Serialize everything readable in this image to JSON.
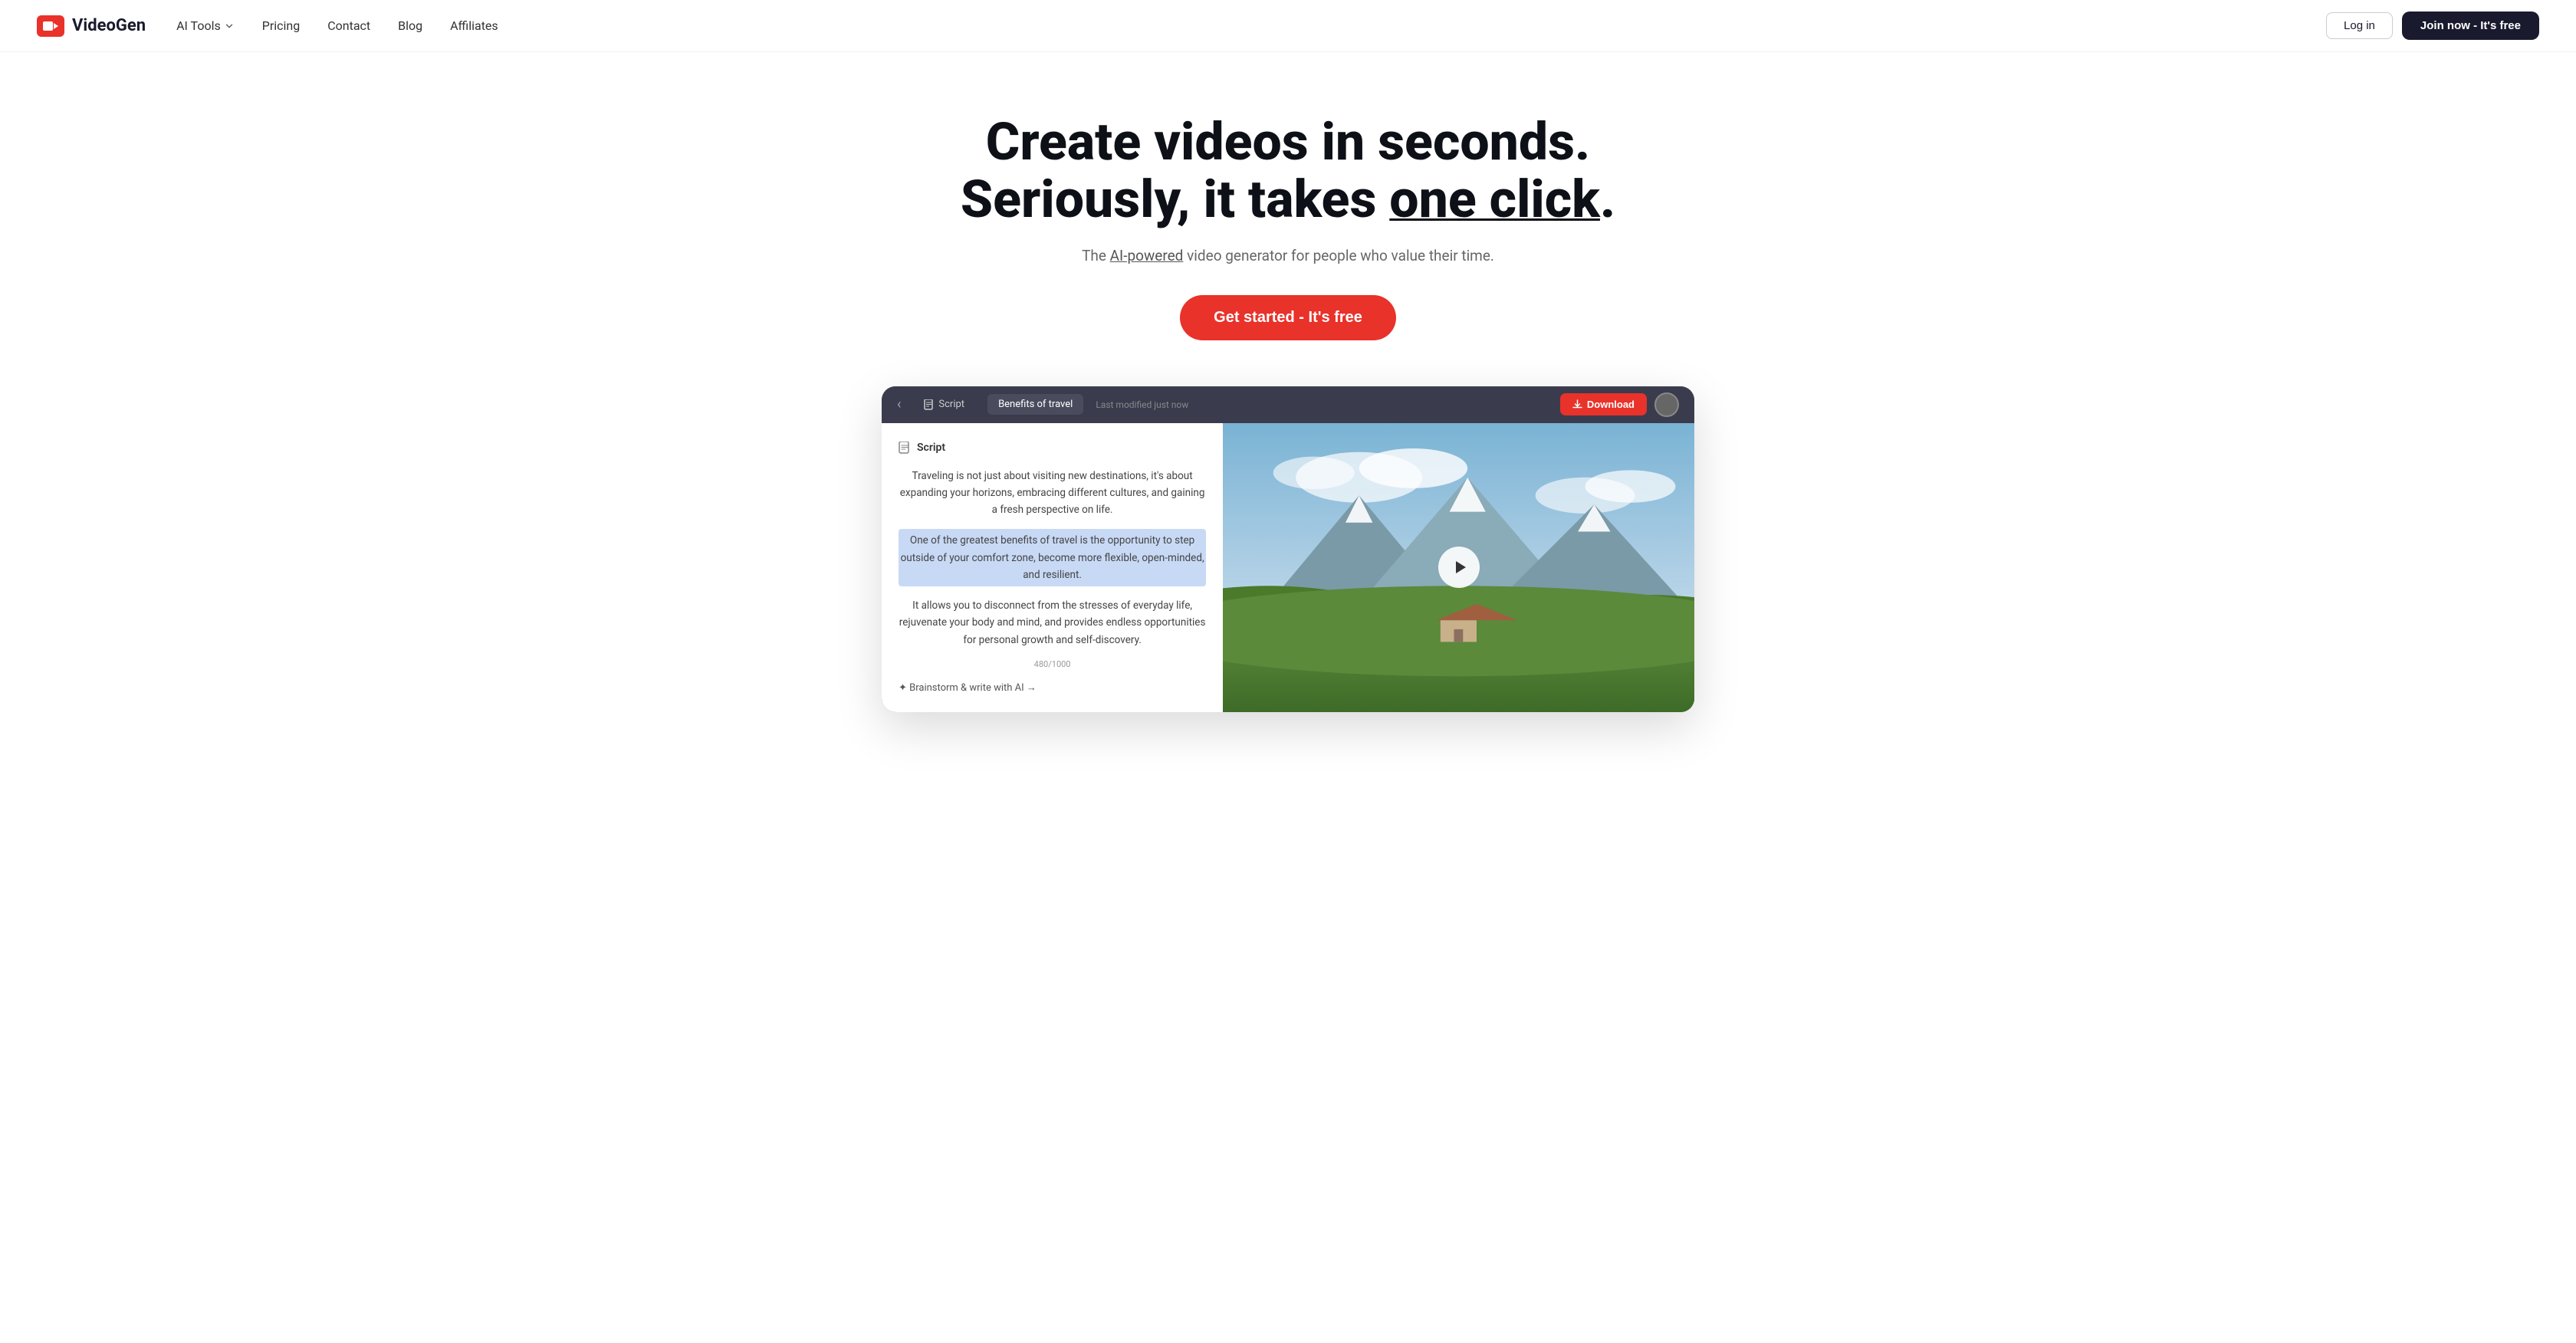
{
  "navbar": {
    "logo_text": "VideoGen",
    "nav_items": [
      {
        "label": "AI Tools",
        "has_dropdown": true,
        "id": "ai-tools"
      },
      {
        "label": "Pricing",
        "has_dropdown": false,
        "id": "pricing"
      },
      {
        "label": "Contact",
        "has_dropdown": false,
        "id": "contact"
      },
      {
        "label": "Blog",
        "has_dropdown": false,
        "id": "blog"
      },
      {
        "label": "Affiliates",
        "has_dropdown": false,
        "id": "affiliates"
      }
    ],
    "login_label": "Log in",
    "join_label": "Join now - It's free"
  },
  "hero": {
    "title_line1": "Create videos in seconds.",
    "title_line2_pre": "Seriously, it takes ",
    "title_line2_highlight": "one click",
    "title_line2_post": ".",
    "subtitle_pre": "The ",
    "subtitle_link": "AI-powered",
    "subtitle_post": " video generator for people who value their time.",
    "cta_label_bold": "Get started",
    "cta_label_rest": " - It's free"
  },
  "app_preview": {
    "back_button": "‹",
    "tabs": [
      {
        "label": "Script",
        "icon": "document",
        "active": false
      },
      {
        "label": "Benefits of travel",
        "icon": "",
        "active": true
      }
    ],
    "last_modified": "Last modified just now",
    "download_label": "Download",
    "script_section": {
      "heading": "Script",
      "paragraphs": [
        {
          "text": "Traveling is not just about visiting new destinations, it's about expanding your horizons, embracing different cultures, and gaining a fresh perspective on life.",
          "highlighted": false
        },
        {
          "text": "One of the greatest benefits of travel is the opportunity to step outside of your comfort zone, become more flexible, open-minded, and resilient.",
          "highlighted": true
        },
        {
          "text": "It allows you to disconnect from the stresses of everyday life, rejuvenate your body and mind, and provides endless opportunities for personal growth and self-discovery.",
          "highlighted": false
        }
      ],
      "word_count": "480/1000",
      "brainstorm_label": "✦ Brainstorm & write with AI →"
    }
  }
}
